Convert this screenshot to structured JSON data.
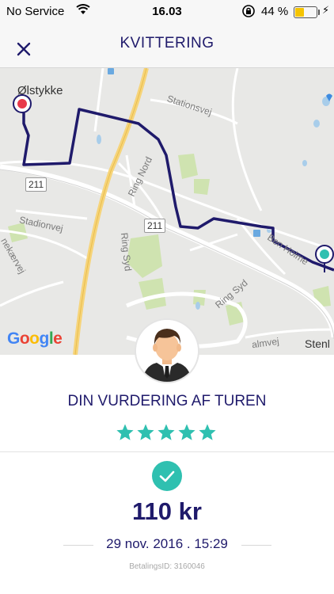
{
  "status_bar": {
    "carrier": "No Service",
    "time": "16.03",
    "battery_percent": "44 %",
    "battery_level": 0.44
  },
  "header": {
    "title": "KVITTERING",
    "close_icon": "close-icon"
  },
  "map": {
    "town_label": "Ølstykke",
    "street_labels": {
      "stationsvej": "Stationsvej",
      "ring_nord": "Ring Nord",
      "ring_syd_1": "Ring Syd",
      "ring_syd_2": "Ring Syd",
      "stadionvej": "Stadionvej",
      "ekaervej": "nekærvej",
      "holme": "Ben Holme",
      "almvej": "almvej",
      "stenl": "Stenl"
    },
    "road_shields": {
      "r211_a": "211",
      "r211_b": "211"
    },
    "attribution": "Google",
    "colors": {
      "route": "#1f1a6b",
      "start_pin": "#e8394a",
      "end_pin": "#2fc0b0"
    }
  },
  "driver": {
    "avatar_icon": "driver-avatar-icon"
  },
  "rating": {
    "title": "DIN VURDERING AF TUREN",
    "stars": 5,
    "max_stars": 5,
    "star_color": "#2fc0b0"
  },
  "receipt": {
    "check_icon": "checkmark-icon",
    "price": "110 kr",
    "date": "29 nov. 2016 . 15:29",
    "payment_id": "BetalingsID: 3160046"
  }
}
